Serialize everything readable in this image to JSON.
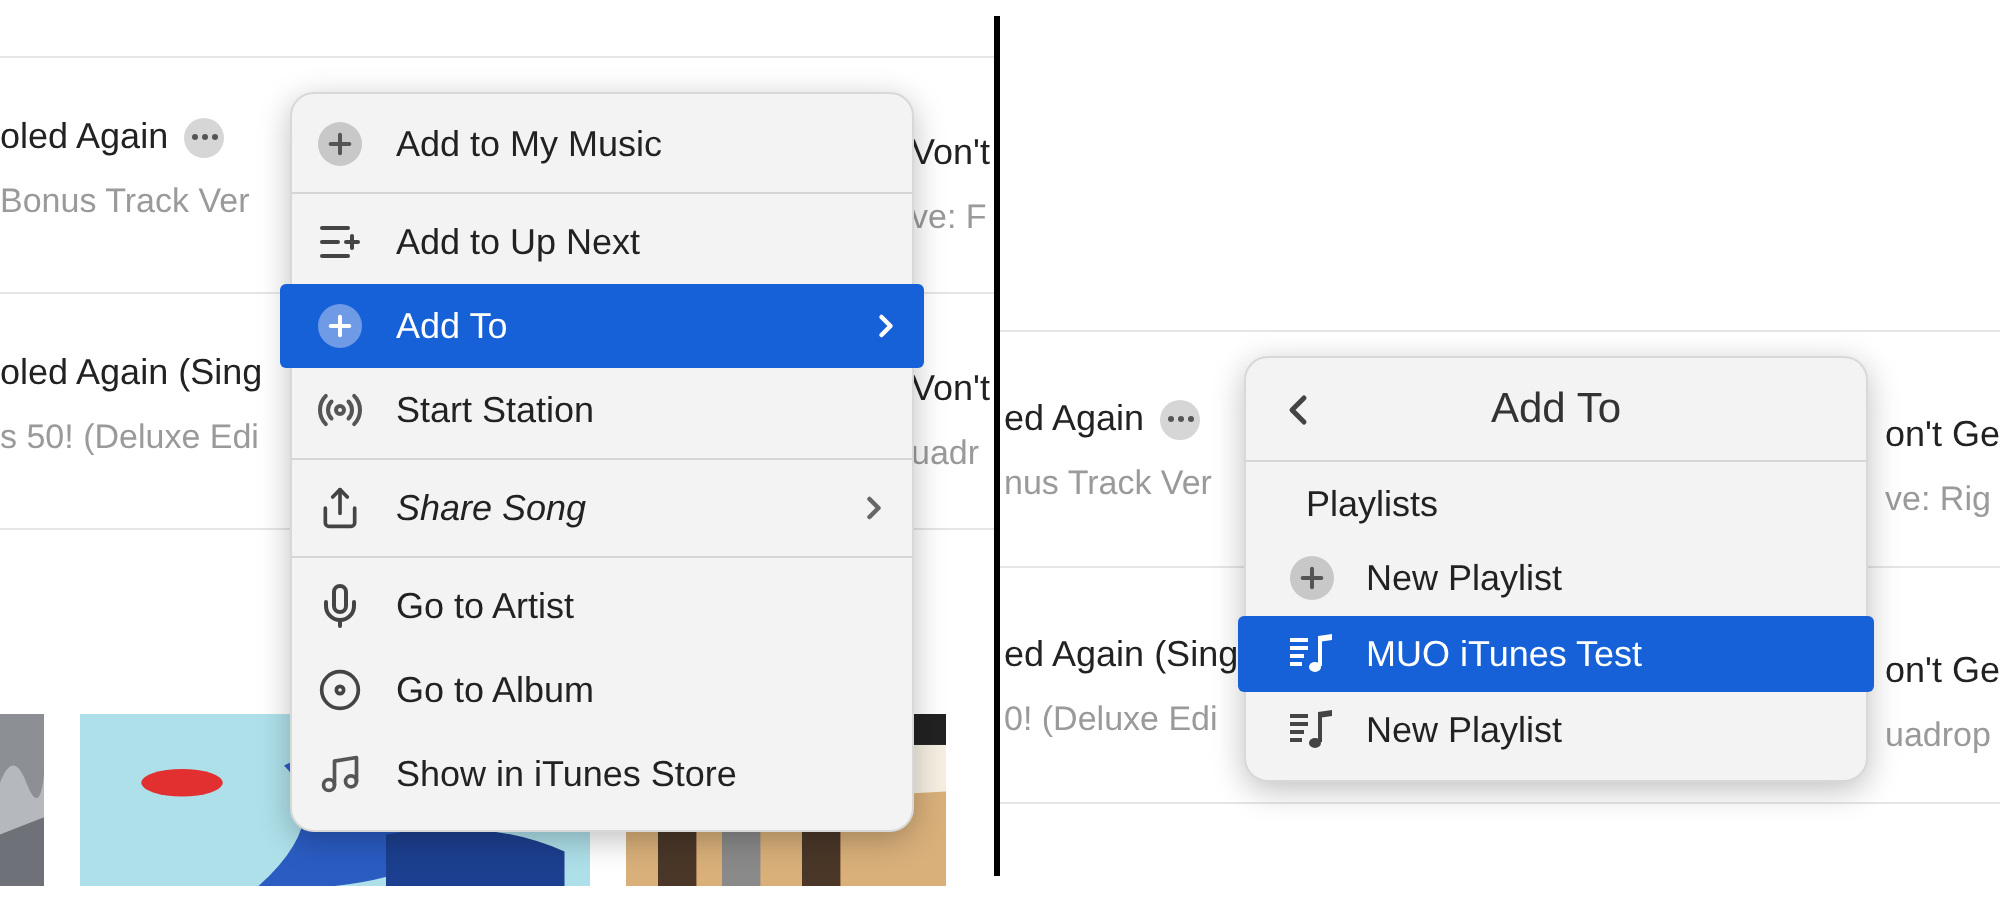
{
  "panels": [
    {
      "rows": [
        {
          "title": "oled Again",
          "subtitle": "Bonus Track Ver",
          "more_button": true,
          "side_title": "Von't",
          "side_subtitle": "ve: F"
        },
        {
          "title": "oled Again (Sing",
          "subtitle": "s 50! (Deluxe Edi",
          "more_button": false,
          "side_title": "Von't",
          "side_subtitle": "uadr"
        }
      ],
      "artwork": [
        {
          "kind": "picture"
        },
        {
          "kind": "picture"
        },
        {
          "kind": "picture"
        }
      ],
      "menu": {
        "groups": [
          [
            {
              "label": "Add to My Music",
              "selected": false,
              "submenu": false,
              "italic": false
            }
          ],
          [
            {
              "label": "Add to Up Next",
              "selected": false,
              "submenu": false,
              "italic": false
            },
            {
              "label": "Add To",
              "selected": true,
              "submenu": true,
              "italic": false
            },
            {
              "label": "Start Station",
              "selected": false,
              "submenu": false,
              "italic": false
            }
          ],
          [
            {
              "label": "Share Song",
              "selected": false,
              "submenu": true,
              "italic": true
            }
          ],
          [
            {
              "label": "Go to Artist",
              "selected": false,
              "submenu": false,
              "italic": false
            },
            {
              "label": "Go to Album",
              "selected": false,
              "submenu": false,
              "italic": false
            },
            {
              "label": "Show in iTunes Store",
              "selected": false,
              "submenu": false,
              "italic": false
            }
          ]
        ]
      }
    },
    {
      "rows": [
        {
          "title": "ed Again",
          "subtitle": "nus Track Ver",
          "more_button": true,
          "side_title": "on't Ge",
          "side_subtitle": "ve: Rig"
        },
        {
          "title": "ed Again (Sing",
          "subtitle": "0! (Deluxe Edi",
          "side_title": "on't Ge",
          "side_subtitle": "uadrop"
        }
      ],
      "menu": {
        "title": "Add To",
        "section": "Playlists",
        "items": [
          {
            "kind": "add",
            "label": "New Playlist",
            "selected": false
          },
          {
            "kind": "playlist",
            "label": "MUO iTunes Test",
            "selected": true
          },
          {
            "kind": "playlist",
            "label": "New Playlist",
            "selected": false
          }
        ]
      }
    }
  ]
}
